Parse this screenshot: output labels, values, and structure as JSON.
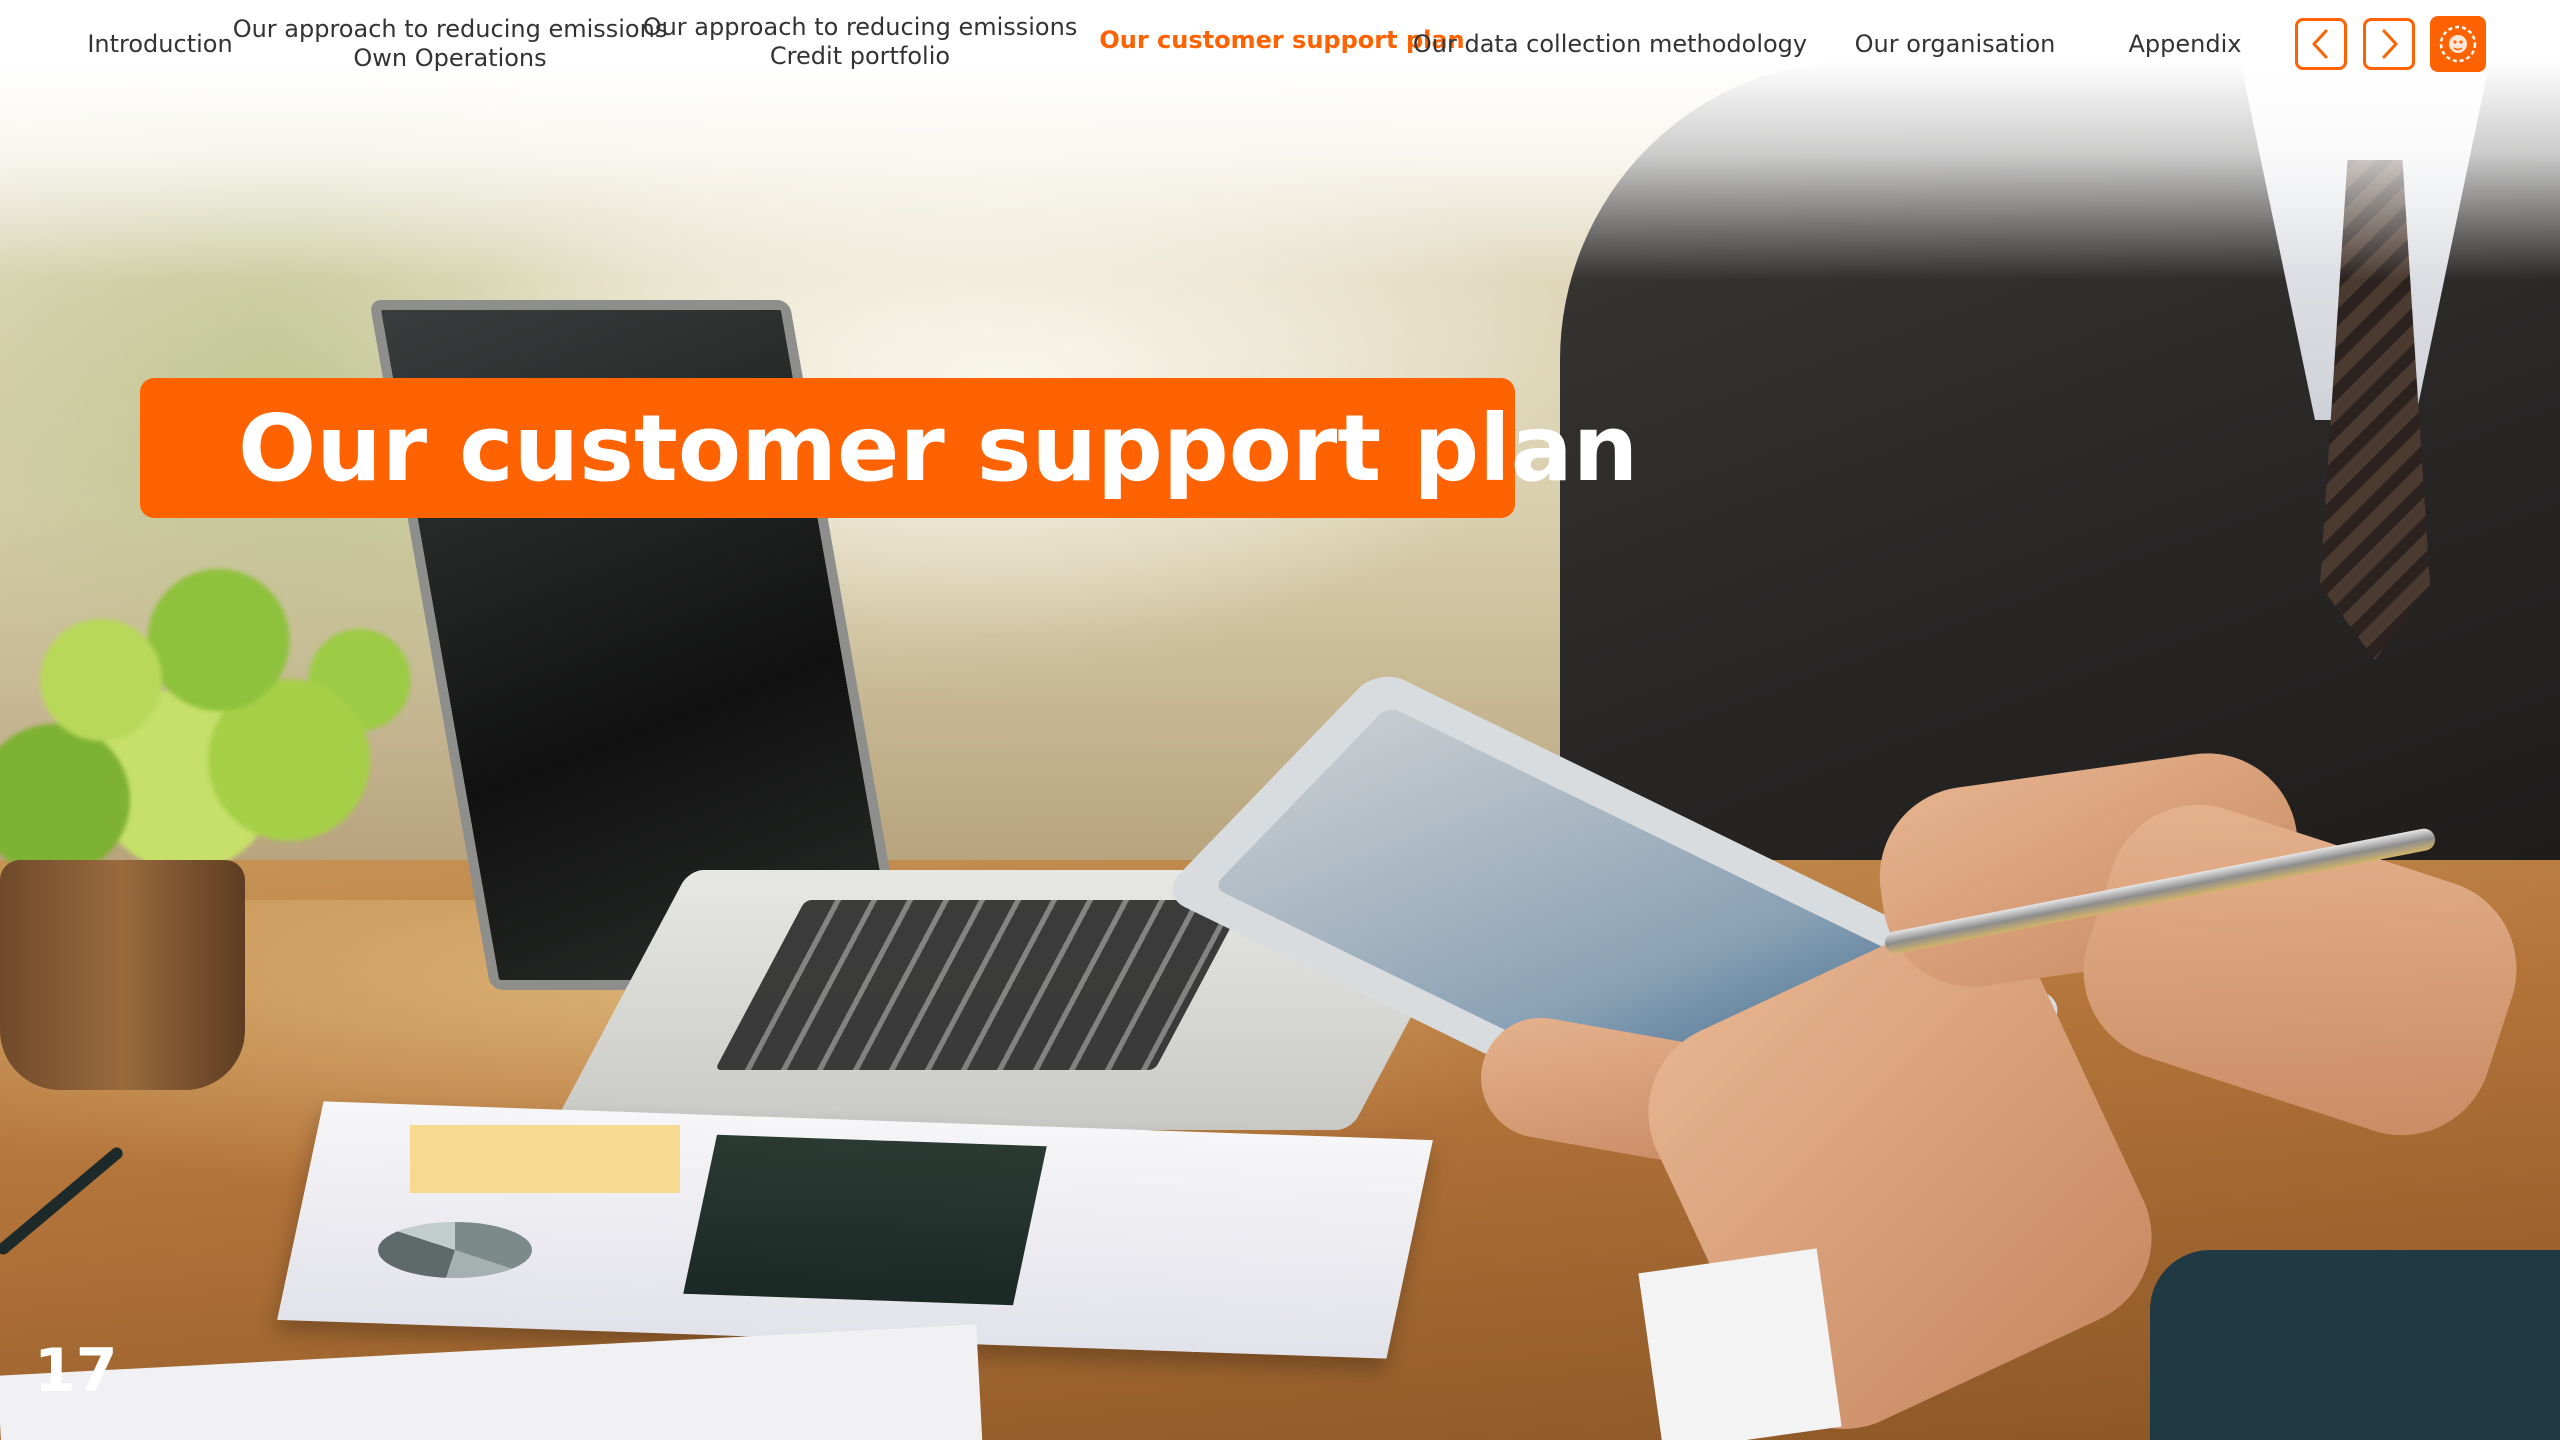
{
  "nav": {
    "items": [
      {
        "lines": [
          "Introduction"
        ],
        "active": false
      },
      {
        "lines": [
          "Our approach to reducing emissions",
          "Own Operations"
        ],
        "active": false
      },
      {
        "lines": [
          "Our approach to reducing emissions",
          "Credit portfolio"
        ],
        "active": false
      },
      {
        "lines": [
          "Our customer support plan"
        ],
        "active": true
      },
      {
        "lines": [
          "Our data collection methodology"
        ],
        "active": false
      },
      {
        "lines": [
          "Our organisation"
        ],
        "active": false
      },
      {
        "lines": [
          "Appendix"
        ],
        "active": false
      }
    ],
    "prev_icon": "chevron-left-icon",
    "next_icon": "chevron-right-icon",
    "logo_icon": "lion-logo-icon"
  },
  "slide": {
    "title": "Our customer support plan",
    "page_number": "17"
  },
  "colors": {
    "accent": "#ff6200",
    "nav_text": "#333333",
    "title_text": "#ffffff"
  }
}
